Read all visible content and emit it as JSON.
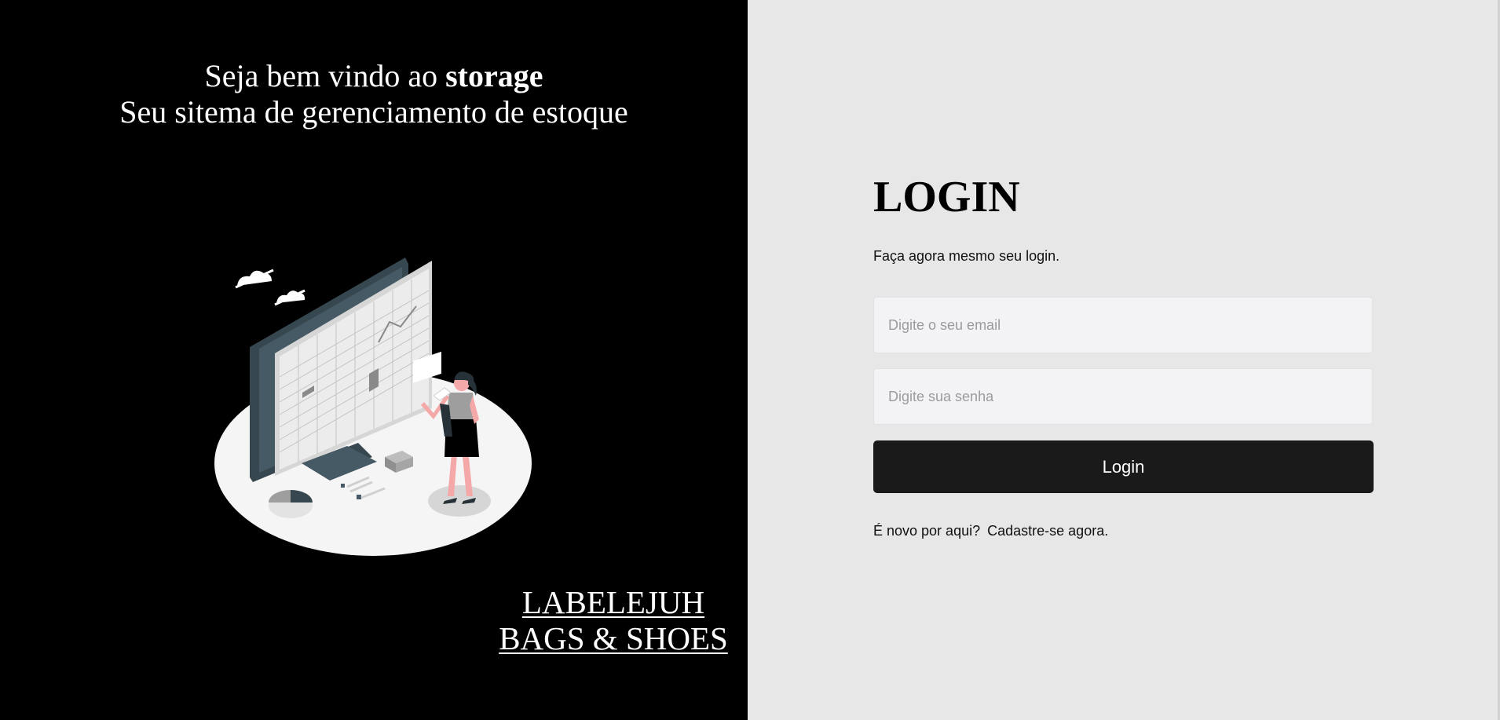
{
  "hero": {
    "welcome_prefix": "Seja bem vindo ao ",
    "welcome_brand": "storage",
    "welcome_line2": "Seu sitema de gerenciamento de estoque"
  },
  "brand": {
    "line1": "LABELEJUH",
    "line2": "BAGS & SHOES"
  },
  "login": {
    "title": "LOGIN",
    "subtitle": "Faça agora mesmo seu login.",
    "email_placeholder": "Digite o seu email",
    "email_value": "",
    "password_placeholder": "Digite sua senha",
    "password_value": "",
    "button_label": "Login",
    "signup_prompt": "É novo por aqui?",
    "signup_link": "Cadastre-se agora."
  },
  "colors": {
    "left_background": "#000000",
    "right_background": "#e7e7e7",
    "button_background": "#1a1a1a",
    "input_background": "#f3f3f5",
    "illustration_accent": "#f4a9a8"
  },
  "icons": {
    "illustration": "inventory-dashboard-illustration"
  }
}
